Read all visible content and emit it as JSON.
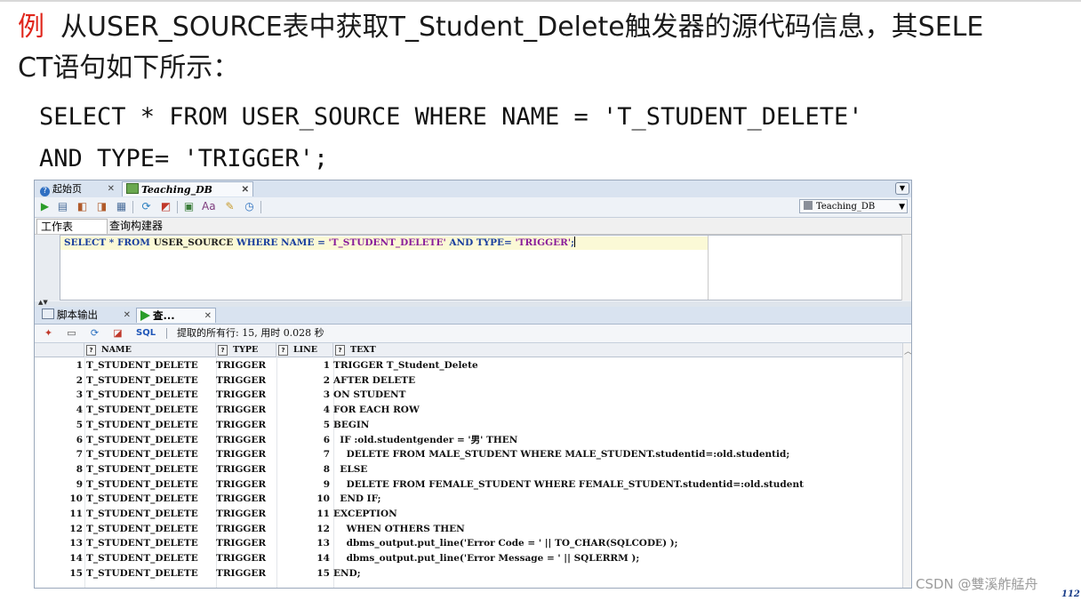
{
  "heading": {
    "example_marker": "例",
    "text_line1": "从USER_SOURCE表中获取T_Student_Delete触发器的源代码信息，其SELE",
    "text_line2": "CT语句如下所示："
  },
  "sql_statement": {
    "line1": "SELECT * FROM USER_SOURCE WHERE NAME = 'T_STUDENT_DELETE'",
    "line2": "AND TYPE= 'TRIGGER';"
  },
  "ide": {
    "tabs": [
      {
        "label": "起始页",
        "icon": "help-icon"
      },
      {
        "label": "Teaching_DB",
        "icon": "database-icon"
      }
    ],
    "connection_selector": "Teaching_DB",
    "subtabs": [
      "工作表",
      "查询构建器"
    ],
    "editor": {
      "keyword_select": "SELECT",
      "star": " * ",
      "keyword_from": "FROM",
      "table": " USER_SOURCE ",
      "keyword_where": "WHERE",
      "name_col": " NAME = ",
      "name_val": "'T_STUDENT_DELETE'",
      "keyword_and": "AND",
      "type_col": " TYPE= ",
      "type_val": "'TRIGGER'",
      "semicolon": ";"
    },
    "output_tabs": [
      {
        "label": "脚本输出",
        "icon": "script-icon"
      },
      {
        "label": "查...",
        "icon": "play-icon"
      }
    ],
    "results_toolbar": {
      "sql_label": "SQL",
      "status": "提取的所有行: 15, 用时 0.028 秒"
    },
    "grid": {
      "columns": [
        "NAME",
        "TYPE",
        "LINE",
        "TEXT"
      ],
      "rows": [
        {
          "n": "1",
          "name": "T_STUDENT_DELETE",
          "type": "TRIGGER",
          "line": "1",
          "text": "TRIGGER T_Student_Delete"
        },
        {
          "n": "2",
          "name": "T_STUDENT_DELETE",
          "type": "TRIGGER",
          "line": "2",
          "text": "AFTER DELETE"
        },
        {
          "n": "3",
          "name": "T_STUDENT_DELETE",
          "type": "TRIGGER",
          "line": "3",
          "text": "ON STUDENT"
        },
        {
          "n": "4",
          "name": "T_STUDENT_DELETE",
          "type": "TRIGGER",
          "line": "4",
          "text": "FOR EACH ROW"
        },
        {
          "n": "5",
          "name": "T_STUDENT_DELETE",
          "type": "TRIGGER",
          "line": "5",
          "text": "BEGIN"
        },
        {
          "n": "6",
          "name": "T_STUDENT_DELETE",
          "type": "TRIGGER",
          "line": "6",
          "text": "  IF :old.studentgender = '男' THEN"
        },
        {
          "n": "7",
          "name": "T_STUDENT_DELETE",
          "type": "TRIGGER",
          "line": "7",
          "text": "    DELETE FROM MALE_STUDENT WHERE MALE_STUDENT.studentid=:old.studentid;"
        },
        {
          "n": "8",
          "name": "T_STUDENT_DELETE",
          "type": "TRIGGER",
          "line": "8",
          "text": "  ELSE"
        },
        {
          "n": "9",
          "name": "T_STUDENT_DELETE",
          "type": "TRIGGER",
          "line": "9",
          "text": "    DELETE FROM FEMALE_STUDENT WHERE FEMALE_STUDENT.studentid=:old.student"
        },
        {
          "n": "10",
          "name": "T_STUDENT_DELETE",
          "type": "TRIGGER",
          "line": "10",
          "text": "  END IF;"
        },
        {
          "n": "11",
          "name": "T_STUDENT_DELETE",
          "type": "TRIGGER",
          "line": "11",
          "text": "EXCEPTION"
        },
        {
          "n": "12",
          "name": "T_STUDENT_DELETE",
          "type": "TRIGGER",
          "line": "12",
          "text": "    WHEN OTHERS THEN"
        },
        {
          "n": "13",
          "name": "T_STUDENT_DELETE",
          "type": "TRIGGER",
          "line": "13",
          "text": "    dbms_output.put_line('Error Code = ' || TO_CHAR(SQLCODE) );"
        },
        {
          "n": "14",
          "name": "T_STUDENT_DELETE",
          "type": "TRIGGER",
          "line": "14",
          "text": "    dbms_output.put_line('Error Message = ' || SQLERRM );"
        },
        {
          "n": "15",
          "name": "T_STUDENT_DELETE",
          "type": "TRIGGER",
          "line": "15",
          "text": "END;"
        }
      ]
    }
  },
  "footer": {
    "watermark": "CSDN @雙溪舴艋舟",
    "page_number": "112"
  },
  "colors": {
    "example_marker": "#e0261b",
    "sql_keyword": "#1a3f9e",
    "sql_string": "#8a1f9a",
    "sql_link": "#1f56b8"
  }
}
